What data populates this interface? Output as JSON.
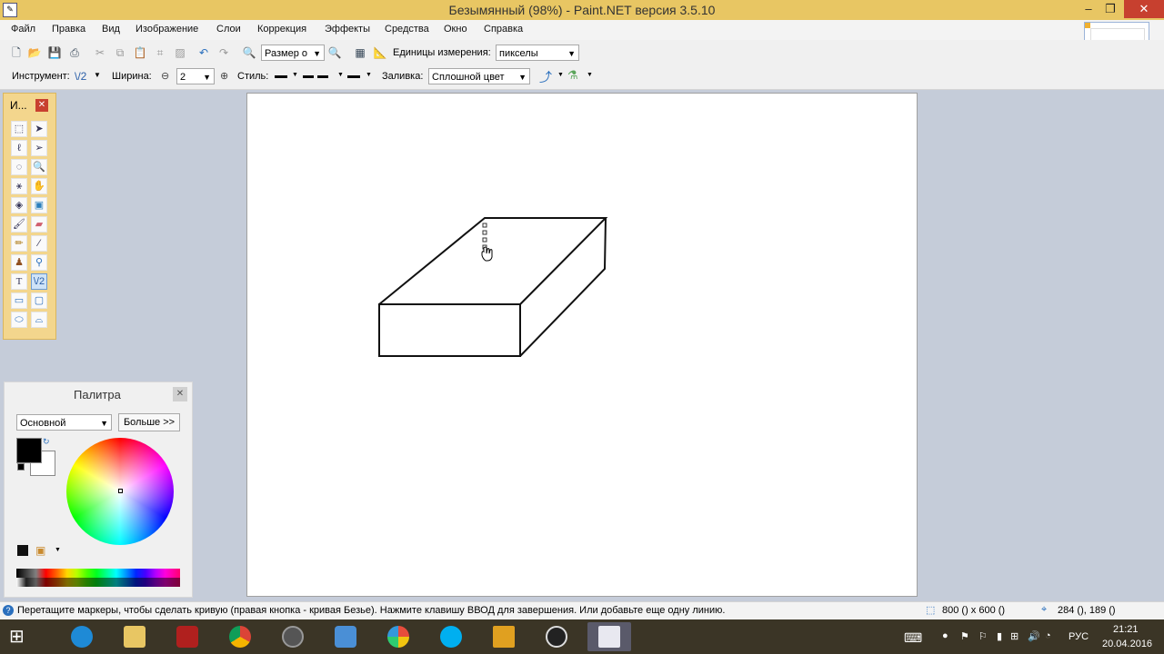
{
  "window": {
    "title": "Безымянный (98%) - Paint.NET версия 3.5.10"
  },
  "menu": [
    "Файл",
    "Правка",
    "Вид",
    "Изображение",
    "Слои",
    "Коррекция",
    "Эффекты",
    "Средства",
    "Окно",
    "Справка"
  ],
  "toolbar": {
    "zoom_select": "Размер о",
    "units_label": "Единицы измерения:",
    "units_value": "пикселы"
  },
  "toolbar2": {
    "tool_label": "Инструмент:",
    "tool_value": "\\/2",
    "width_label": "Ширина:",
    "width_value": "2",
    "style_label": "Стиль:",
    "fill_label": "Заливка:",
    "fill_value": "Сплошной цвет"
  },
  "tools_window": {
    "title": "И..."
  },
  "palette": {
    "title": "Палитра",
    "mode": "Основной",
    "more_button": "Больше >>",
    "primary_color": "#000000",
    "secondary_color": "#ffffff"
  },
  "status": {
    "hint": "Перетащите маркеры, чтобы сделать кривую (правая кнопка - кривая Безье). Нажмите клавишу ВВОД для завершения. Или добавьте еще одну линию.",
    "image_size": "800 () x 600 ()",
    "cursor_pos": "284 (), 189 ()"
  },
  "taskbar": {
    "lang": "РУС",
    "time": "21:21",
    "date": "20.04.2016",
    "apps": [
      "internet-explorer",
      "file-explorer",
      "power",
      "chrome",
      "media",
      "speaker",
      "mosaic",
      "skype",
      "cs-go",
      "obs",
      "paint-net"
    ]
  },
  "colors": {
    "title_bar": "#e8c663",
    "accent": "#c8402f",
    "tools_bg": "#f3d68d"
  }
}
